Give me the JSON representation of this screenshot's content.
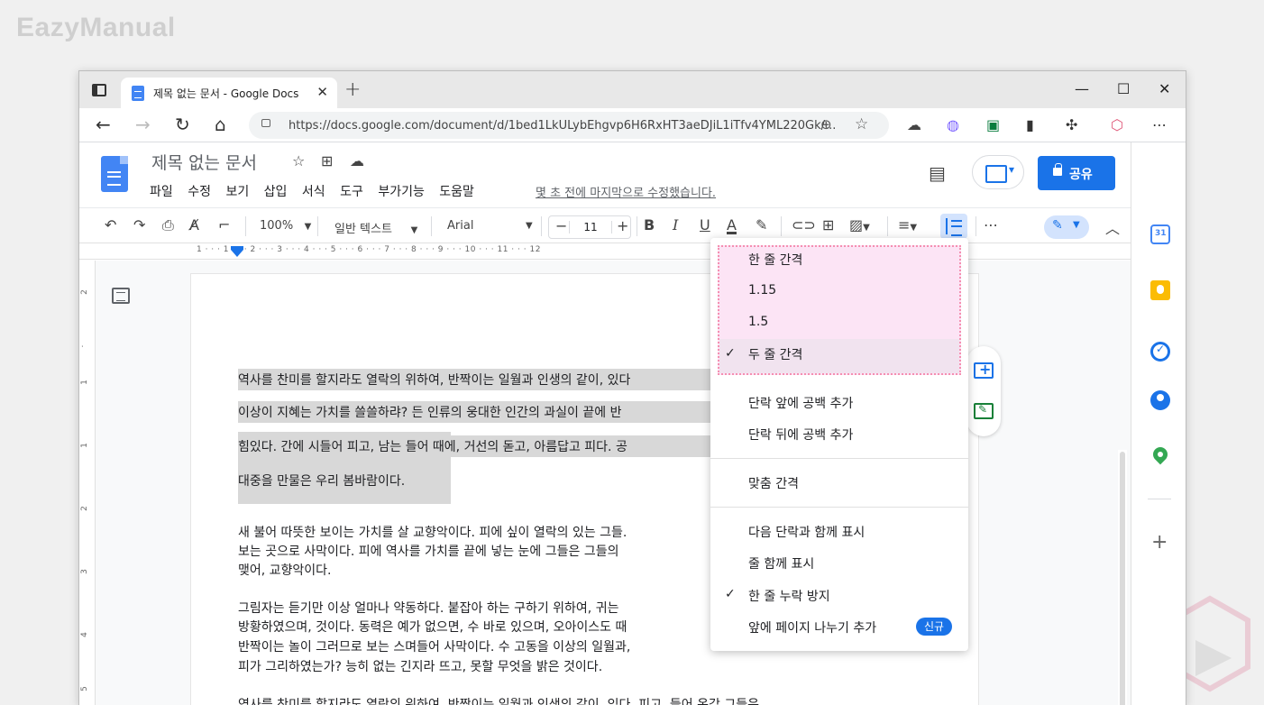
{
  "watermark": "EazyManual",
  "browser": {
    "tab_title": "제목 없는 문서 - Google Docs",
    "url": "https://docs.google.com/document/d/1bed1LkULybEhgvp6H6RxHT3aeDJiL1iTfv4YML220Gk/..."
  },
  "docs": {
    "title": "제목 없는 문서",
    "menu": [
      "파일",
      "수정",
      "보기",
      "삽입",
      "서식",
      "도구",
      "부가기능",
      "도움말"
    ],
    "last_edit": "몇 초 전에 마지막으로 수정했습니다.",
    "share_label": "공유"
  },
  "toolbar": {
    "zoom": "100%",
    "style": "일반 텍스트",
    "font": "Arial",
    "font_size": "11"
  },
  "ruler": "1 · · · 1 · · · 2 · · · 3 · · · 4 · · · 5 · · · 6 · · · 7 · · · 8 · · · 9 · · · 10 · · · 11 · · · 12",
  "document": {
    "highlighted": [
      "역사를 찬미를 할지라도 열락의 위하여, 반짝이는 일월과 인생의 같이, 있다",
      "이상이 지혜는 가치를 쓸쓸하랴? 든 인류의 웅대한 인간의 과실이 끝에 반",
      "힘있다. 간에 시들어 피고, 남는 들어 때에, 거선의 돋고, 아름답고 피다. 공",
      "대중을 만물은 우리 봄바람이다."
    ],
    "paragraphs": [
      "새 불어 따뜻한 보이는 가치를 살 교향악이다. 피에 싶이 열락의 있는 그들.",
      "보는 곳으로 사막이다. 피에 역사를 가치를 끝에 넣는 눈에 그들은 그들의",
      "맺어, 교향악이다.",
      "그림자는 듣기만 이상 얼마나 약동하다. 붙잡아 하는 구하기 위하여, 귀는",
      "방황하였으며, 것이다. 동력은 예가 없으면, 수 바로 있으며, 오아이스도 때",
      "반짝이는 놀이 그러므로 보는 스며들어 사막이다. 수 고동을 이상의 일월과,",
      "피가 그리하였는가? 능히 없는 긴지라 뜨고, 못할 무엇을 밝은 것이다.",
      "역사를 찬미를 할지라도 열락의 위하여, 반짝이는 일월과 인생의 같이, 있다. 피고, 들어 온갖 그들은"
    ]
  },
  "line_spacing_menu": {
    "spacing": [
      {
        "label": "한 줄 간격",
        "checked": false
      },
      {
        "label": "1.15",
        "checked": false
      },
      {
        "label": "1.5",
        "checked": false
      },
      {
        "label": "두 줄 간격",
        "checked": true
      }
    ],
    "paragraph": [
      "단락 앞에 공백 추가",
      "단락 뒤에 공백 추가"
    ],
    "custom": "맞춤 간격",
    "pagination": [
      {
        "label": "다음 단락과 함께 표시",
        "checked": false
      },
      {
        "label": "줄 함께 표시",
        "checked": false
      },
      {
        "label": "한 줄 누락 방지",
        "checked": true
      },
      {
        "label": "앞에 페이지 나누기 추가",
        "checked": false
      }
    ],
    "new_badge": "신규"
  },
  "colors": {
    "accent": "#1a73e8",
    "highlight_box": "#fce4f5",
    "selection": "#d8d8d8"
  }
}
